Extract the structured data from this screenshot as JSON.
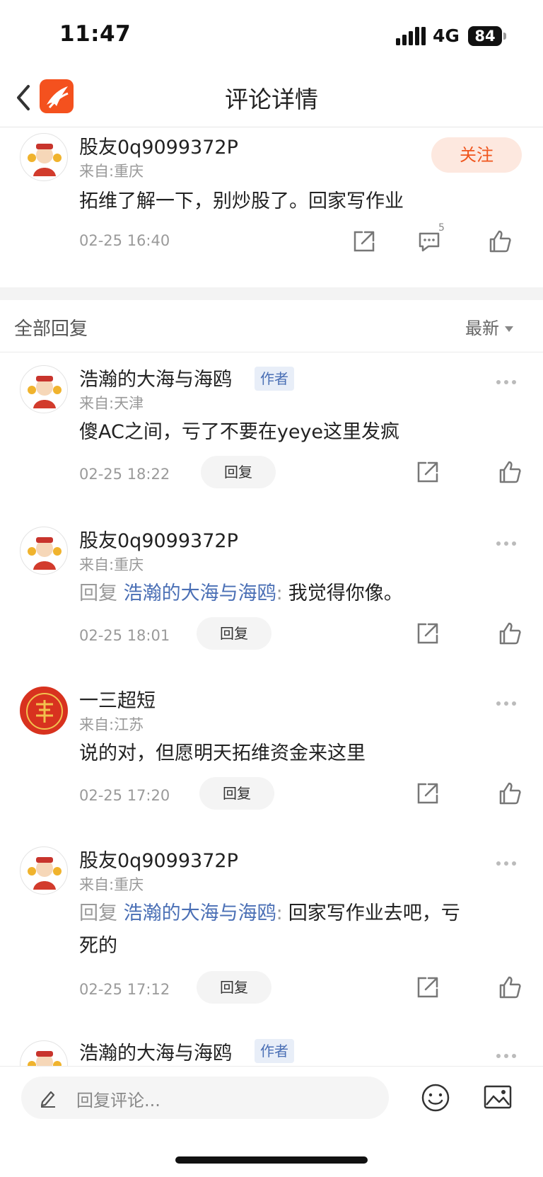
{
  "status_bar": {
    "time": "11:47",
    "network": "4G",
    "battery": "84"
  },
  "nav": {
    "title": "评论详情"
  },
  "main_comment": {
    "username": "股友0q9099372P",
    "from": "来自:重庆",
    "content": "拓维了解一下，别炒股了。回家写作业",
    "time": "02-25 16:40",
    "follow_label": "关注",
    "comment_count": "5"
  },
  "section": {
    "title": "全部回复",
    "sort_label": "最新"
  },
  "replies": [
    {
      "username": "浩瀚的大海与海鸥",
      "author_tag": "作者",
      "from": "来自:天津",
      "content": "傻AC之间，亏了不要在yeye这里发疯",
      "time": "02-25 18:22",
      "reply_label": "回复"
    },
    {
      "username": "股友0q9099372P",
      "from": "来自:重庆",
      "reply_prefix": "回复",
      "reply_target": "浩瀚的大海与海鸥",
      "reply_sep": ":",
      "content": "我觉得你像。",
      "time": "02-25 18:01",
      "reply_label": "回复"
    },
    {
      "username": "一三超短",
      "from": "来自:江苏",
      "content": "说的对，但愿明天拓维资金来这里",
      "time": "02-25 17:20",
      "reply_label": "回复"
    },
    {
      "username": "股友0q9099372P",
      "from": "来自:重庆",
      "reply_prefix": "回复",
      "reply_target": "浩瀚的大海与海鸥",
      "reply_sep": ":",
      "content_line1": "回家写作业去吧，亏",
      "content_line2": "死的",
      "time": "02-25 17:12",
      "reply_label": "回复"
    },
    {
      "username": "浩瀚的大海与海鸥",
      "author_tag": "作者"
    }
  ],
  "bottom_bar": {
    "placeholder": "回复评论..."
  },
  "colors": {
    "accent": "#f0561e",
    "link": "#4a6fb5",
    "muted": "#999999"
  }
}
